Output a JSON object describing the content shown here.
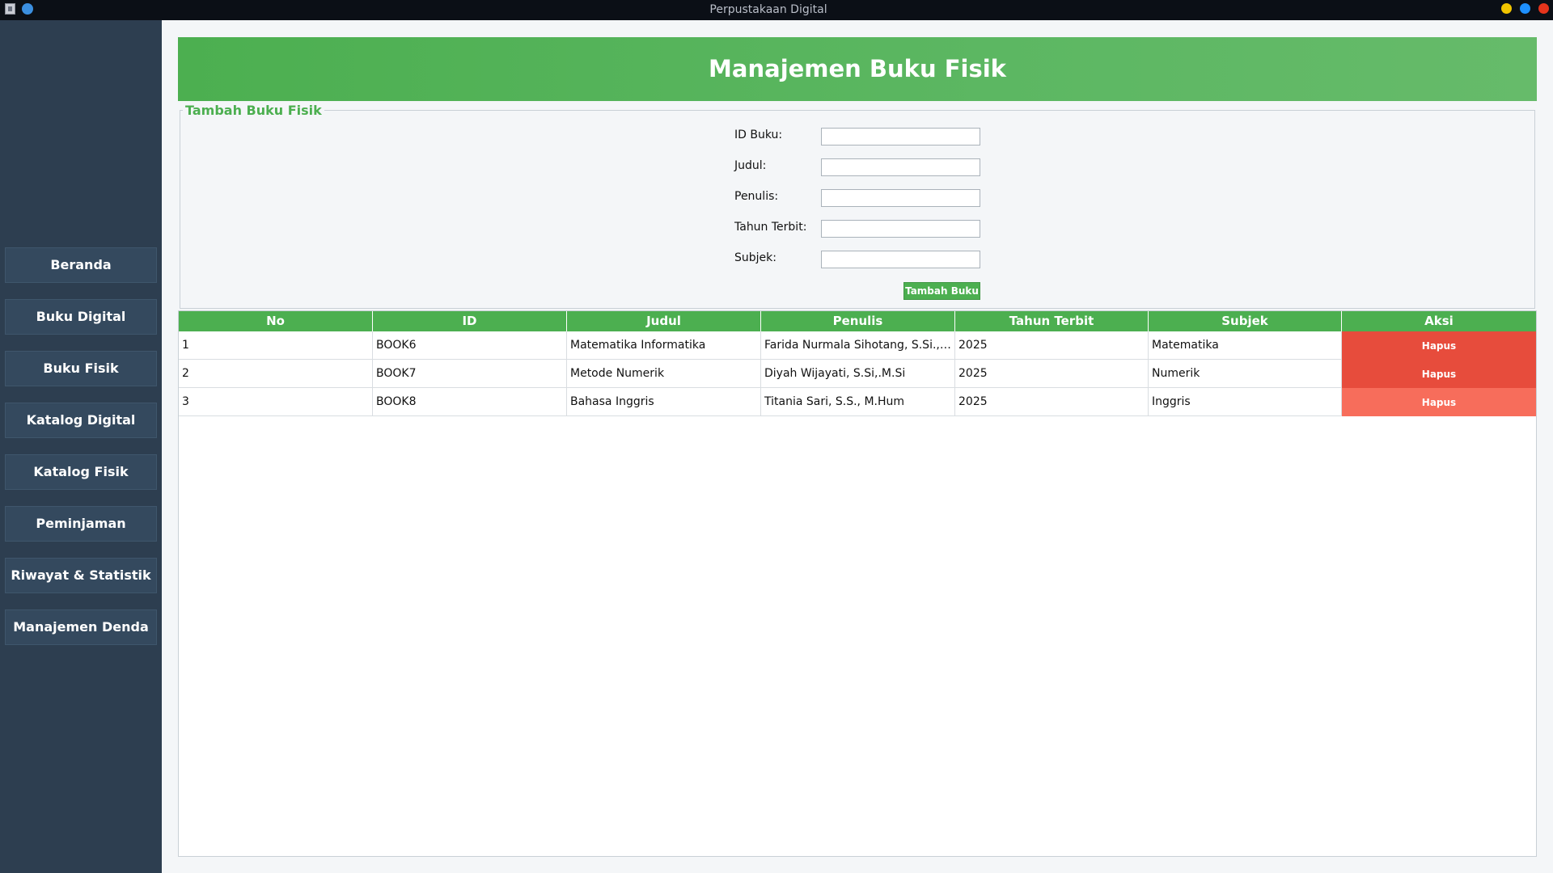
{
  "window": {
    "title": "Perpustakaan Digital"
  },
  "sidebar": {
    "items": [
      {
        "label": "Beranda"
      },
      {
        "label": "Buku Digital"
      },
      {
        "label": "Buku Fisik"
      },
      {
        "label": "Katalog Digital"
      },
      {
        "label": "Katalog Fisik"
      },
      {
        "label": "Peminjaman"
      },
      {
        "label": "Riwayat & Statistik"
      },
      {
        "label": "Manajemen Denda"
      }
    ]
  },
  "header": {
    "title": "Manajemen Buku Fisik"
  },
  "form": {
    "legend": "Tambah Buku Fisik",
    "fields": [
      {
        "label": "ID Buku:",
        "value": ""
      },
      {
        "label": "Judul:",
        "value": ""
      },
      {
        "label": "Penulis:",
        "value": ""
      },
      {
        "label": "Tahun Terbit:",
        "value": ""
      },
      {
        "label": "Subjek:",
        "value": ""
      }
    ],
    "submit_label": "Tambah Buku"
  },
  "table": {
    "columns": [
      "No",
      "ID",
      "Judul",
      "Penulis",
      "Tahun Terbit",
      "Subjek",
      "Aksi"
    ],
    "rows": [
      {
        "no": "1",
        "id": "BOOK6",
        "judul": "Matematika Informatika",
        "penulis": "Farida Nurmala Sihotang, S.Si.,M...",
        "tahun": "2025",
        "subjek": "Matematika",
        "aksi": "Hapus"
      },
      {
        "no": "2",
        "id": "BOOK7",
        "judul": "Metode Numerik",
        "penulis": "Diyah Wijayati, S.Si,.M.Si",
        "tahun": "2025",
        "subjek": "Numerik",
        "aksi": "Hapus"
      },
      {
        "no": "3",
        "id": "BOOK8",
        "judul": "Bahasa Inggris",
        "penulis": "Titania Sari, S.S., M.Hum",
        "tahun": "2025",
        "subjek": "Inggris",
        "aksi": "Hapus"
      }
    ]
  },
  "colors": {
    "accent": "#4caf50",
    "sidebar": "#2d3e50",
    "danger": "#e74c3c",
    "danger_light": "#f76d5b"
  }
}
